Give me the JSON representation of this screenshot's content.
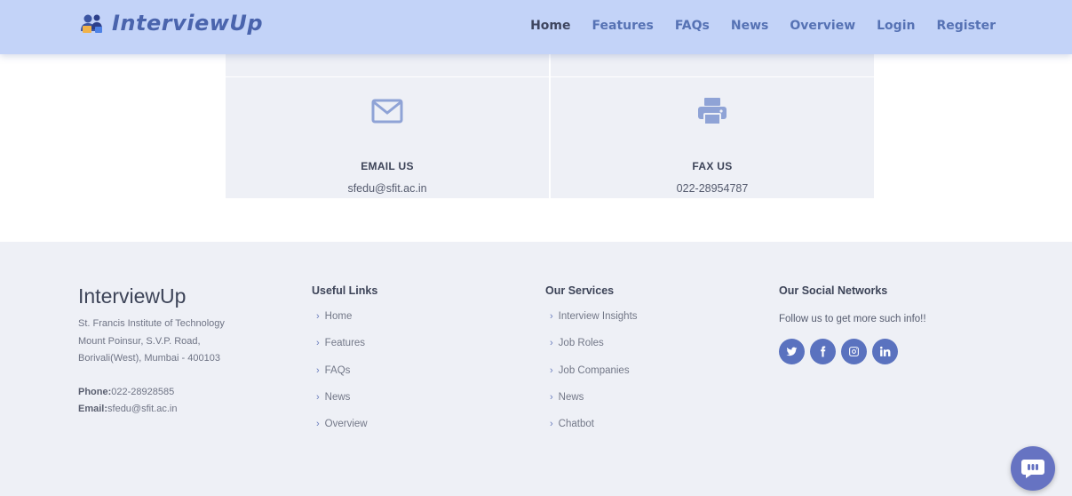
{
  "header": {
    "brand": "InterviewUp",
    "nav": [
      "Home",
      "Features",
      "FAQs",
      "News",
      "Overview",
      "Login",
      "Register"
    ],
    "active": "Home"
  },
  "contact_cards": [
    {
      "icon": "envelope-icon",
      "title": "EMAIL US",
      "value": "sfedu@sfit.ac.in"
    },
    {
      "icon": "printer-icon",
      "title": "FAX US",
      "value": "022-28954787"
    }
  ],
  "footer": {
    "brand": "InterviewUp",
    "address": [
      "St. Francis Institute of Technology",
      "Mount Poinsur, S.V.P. Road,",
      "Borivali(West), Mumbai - 400103"
    ],
    "phone_label": "Phone:",
    "phone": "022-28928585",
    "email_label": "Email:",
    "email": "sfedu@sfit.ac.in",
    "useful_links": {
      "title": "Useful Links",
      "items": [
        "Home",
        "Features",
        "FAQs",
        "News",
        "Overview"
      ]
    },
    "services": {
      "title": "Our Services",
      "items": [
        "Interview Insights",
        "Job Roles",
        "Job Companies",
        "News",
        "Chatbot"
      ]
    },
    "social": {
      "title": "Our Social Networks",
      "text": "Follow us to get more such info!!",
      "icons": [
        "twitter-icon",
        "facebook-icon",
        "instagram-icon",
        "linkedin-icon"
      ]
    }
  },
  "colors": {
    "header_bg": "#c3d3f8",
    "accent": "#5a72bf",
    "footer_bg": "#eef0f6"
  }
}
